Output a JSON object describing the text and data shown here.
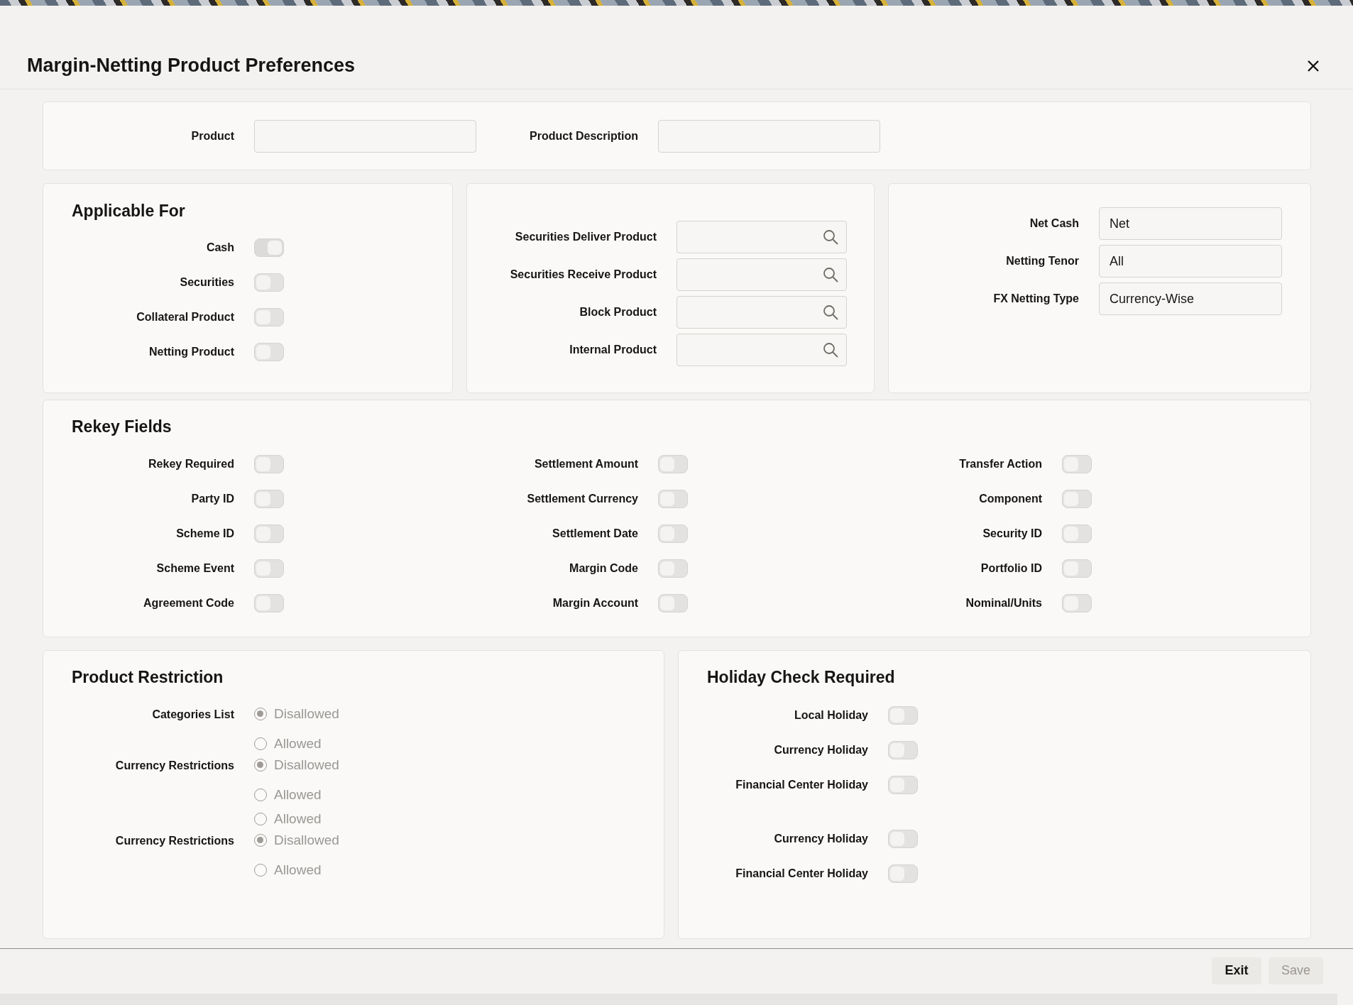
{
  "window": {
    "title": "Margin-Netting Product Preferences"
  },
  "product": [
    {
      "label": "Product"
    },
    {
      "label": "Product Description"
    }
  ],
  "applicable_for": {
    "title": "Applicable For",
    "toggles": [
      {
        "label": "Cash",
        "on": true
      },
      {
        "label": "Securities",
        "on": false
      },
      {
        "label": "Collateral Product",
        "on": false
      },
      {
        "label": "Netting Product",
        "on": false
      }
    ]
  },
  "products": [
    {
      "label": "Securities Deliver Product"
    },
    {
      "label": "Securities Receive Product"
    },
    {
      "label": "Block Product"
    },
    {
      "label": "Internal Product"
    }
  ],
  "netting": [
    {
      "label": "Net Cash",
      "value": "Net"
    },
    {
      "label": "Netting Tenor",
      "value": "All"
    },
    {
      "label": "FX Netting Type",
      "value": "Currency-Wise"
    }
  ],
  "rekey_fields": {
    "title": "Rekey Fields",
    "columns": [
      [
        {
          "label": "Rekey Required",
          "on": false
        },
        {
          "label": "Party ID",
          "on": false
        },
        {
          "label": "Scheme ID",
          "on": false
        },
        {
          "label": "Scheme Event",
          "on": false
        },
        {
          "label": "Agreement Code",
          "on": false
        }
      ],
      [
        {
          "label": "Settlement Amount",
          "on": false
        },
        {
          "label": "Settlement Currency",
          "on": false
        },
        {
          "label": "Settlement Date",
          "on": false
        },
        {
          "label": "Margin Code",
          "on": false
        },
        {
          "label": "Margin Account",
          "on": false
        }
      ],
      [
        {
          "label": "Transfer Action",
          "on": false
        },
        {
          "label": "Component",
          "on": false
        },
        {
          "label": "Security ID",
          "on": false
        },
        {
          "label": "Portfolio ID",
          "on": false
        },
        {
          "label": "Nominal/Units",
          "on": false
        }
      ]
    ]
  },
  "product_restriction": {
    "title": "Product Restriction",
    "groups": [
      {
        "label": "Categories List",
        "options": [
          {
            "label": "Disallowed",
            "selected": true
          },
          {
            "label": "Allowed",
            "selected": false
          }
        ]
      },
      {
        "label": "Currency Restrictions",
        "options": [
          {
            "label": "Disallowed",
            "selected": true
          },
          {
            "label": "Allowed",
            "selected": false
          },
          {
            "label": "Allowed",
            "selected": false
          }
        ]
      },
      {
        "label": "Currency Restrictions",
        "options": [
          {
            "label": "Disallowed",
            "selected": true
          },
          {
            "label": "Allowed",
            "selected": false
          }
        ]
      }
    ]
  },
  "holiday_check": {
    "title": "Holiday Check Required",
    "groups": [
      [
        {
          "label": "Local Holiday",
          "on": false
        },
        {
          "label": "Currency Holiday",
          "on": false
        },
        {
          "label": "Financial Center Holiday",
          "on": false
        }
      ],
      [
        {
          "label": "Currency Holiday",
          "on": false
        },
        {
          "label": "Financial Center Holiday",
          "on": false
        }
      ]
    ]
  },
  "buttons": [
    {
      "label": "Exit",
      "disabled": false
    },
    {
      "label": "Save",
      "disabled": true
    }
  ]
}
